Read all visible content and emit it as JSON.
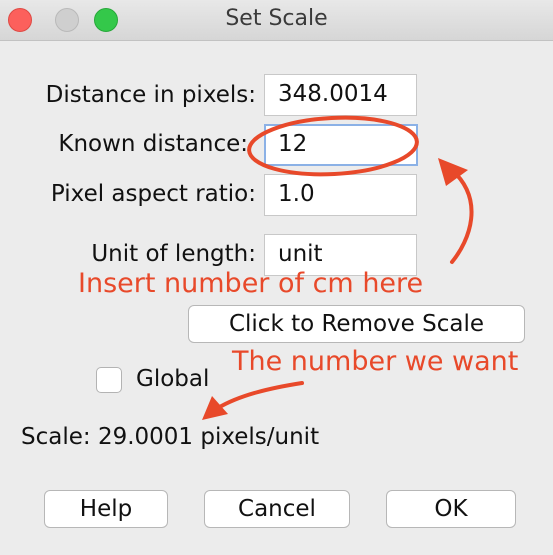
{
  "window": {
    "title": "Set Scale"
  },
  "form": {
    "distance_label": "Distance in pixels:",
    "distance_value": "348.0014",
    "known_label": "Known distance:",
    "known_value": "12",
    "aspect_label": "Pixel aspect ratio:",
    "aspect_value": "1.0",
    "unit_label": "Unit of length:",
    "unit_value": "unit",
    "remove_scale_label": "Click to Remove Scale",
    "global_label": "Global",
    "global_checked": false,
    "scale_text": "Scale: 29.0001 pixels/unit"
  },
  "buttons": {
    "help": "Help",
    "cancel": "Cancel",
    "ok": "OK"
  },
  "annotations": {
    "insert_note": "Insert number of cm here",
    "want_note": "The number we want",
    "color": "#e8492a"
  },
  "colors": {
    "close": "#fc605c",
    "maximize": "#34c84a",
    "focus_ring": "#8bb1e6"
  }
}
